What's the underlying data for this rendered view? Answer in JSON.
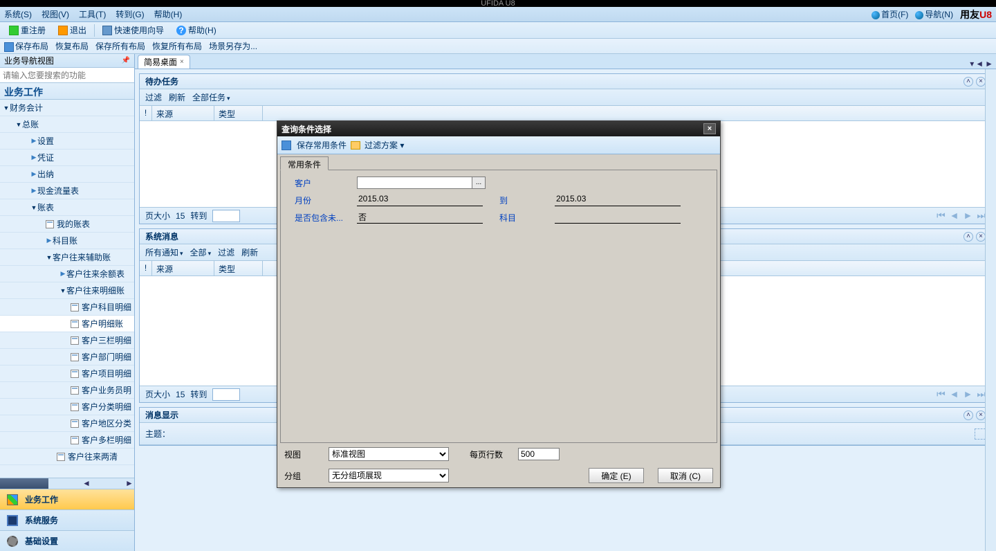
{
  "app_title": "UFIDA U8",
  "menubar": {
    "items": [
      "系统(S)",
      "视图(V)",
      "工具(T)",
      "转到(G)",
      "帮助(H)"
    ],
    "home": "首页(F)",
    "nav": "导航(N)",
    "brand_cn": "用友",
    "brand_en": "U8"
  },
  "toolbar": {
    "reregister": "重注册",
    "exit": "退出",
    "wizard": "快速使用向导",
    "help": "帮助(H)"
  },
  "toolbar2": {
    "save_layout": "保存布局",
    "restore_layout": "恢复布局",
    "save_all_layout": "保存所有布局",
    "restore_all_layout": "恢复所有布局",
    "scene_saveas": "场景另存为..."
  },
  "sidebar": {
    "title": "业务导航视图",
    "search_placeholder": "请输入您要搜索的功能",
    "header": "业务工作",
    "tree": {
      "n0": "财务会计",
      "n1": "总账",
      "n2": "设置",
      "n3": "凭证",
      "n4": "出纳",
      "n5": "现金流量表",
      "n6": "账表",
      "n7": "我的账表",
      "n8": "科目账",
      "n9": "客户往来辅助账",
      "n10": "客户往来余额表",
      "n11": "客户往来明细账",
      "n12": "客户科目明细",
      "n13": "客户明细账",
      "n14": "客户三栏明细",
      "n15": "客户部门明细",
      "n16": "客户项目明细",
      "n17": "客户业务员明",
      "n18": "客户分类明细",
      "n19": "客户地区分类",
      "n20": "客户多栏明细",
      "n21": "客户往来两清"
    },
    "bottom": {
      "work": "业务工作",
      "service": "系统服务",
      "base": "基础设置"
    }
  },
  "content": {
    "tab1": "简易桌面",
    "panel1": {
      "title": "待办任务",
      "filter": "过滤",
      "refresh": "刷新",
      "alltask": "全部任务",
      "col_mark": "!",
      "col_src": "来源",
      "col_type": "类型",
      "pgsize_lbl": "页大小",
      "pgsize_val": "15",
      "goto": "转到"
    },
    "panel2": {
      "title": "系统消息",
      "allnotice": "所有通知",
      "all": "全部",
      "filter": "过滤",
      "refresh": "刷新",
      "col_mark": "!",
      "col_src": "来源",
      "col_type": "类型",
      "pgsize_lbl": "页大小",
      "pgsize_val": "15",
      "goto": "转到"
    },
    "panel3": {
      "title": "消息显示",
      "subject": "主题："
    }
  },
  "dialog": {
    "title": "查询条件选择",
    "save_cond": "保存常用条件",
    "filter_scheme": "过滤方案",
    "tab": "常用条件",
    "f_customer": "客户",
    "f_month": "月份",
    "f_month_from": "2015.03",
    "f_to": "到",
    "f_month_to": "2015.03",
    "f_include": "是否包含未...",
    "f_include_val": "否",
    "f_subject": "科目",
    "view_lbl": "视图",
    "view_val": "标准视图",
    "rows_lbl": "每页行数",
    "rows_val": "500",
    "group_lbl": "分组",
    "group_val": "无分组项展现",
    "ok": "确定 (E)",
    "cancel": "取消 (C)"
  }
}
